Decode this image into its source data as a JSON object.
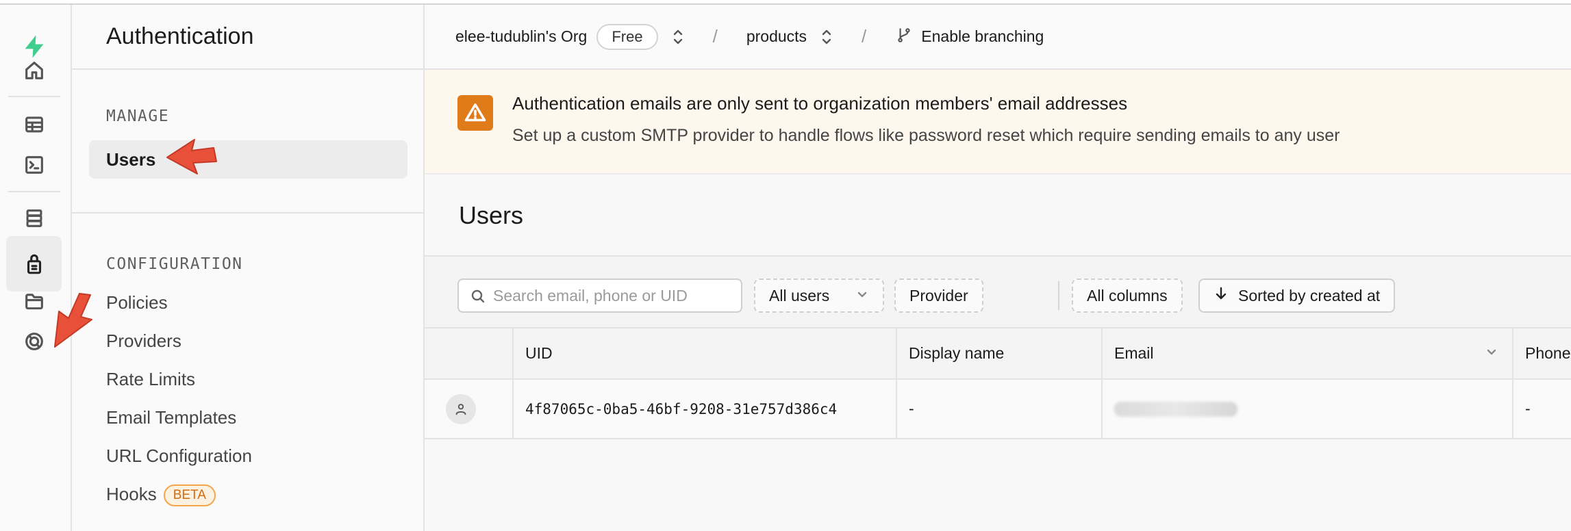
{
  "app": {
    "brand_color": "#3ecf8e",
    "accent_warning": "#e07b1a",
    "annotation_color": "#e8503a"
  },
  "rail": {
    "icons": [
      "logo-icon",
      "home-icon",
      "table-editor-icon",
      "sql-editor-icon",
      "database-icon",
      "authentication-icon",
      "storage-icon",
      "realtime-icon"
    ],
    "active": "authentication-icon"
  },
  "sidebar": {
    "title": "Authentication",
    "sections": [
      {
        "label": "MANAGE",
        "items": [
          {
            "label": "Users",
            "active": true
          }
        ]
      },
      {
        "label": "CONFIGURATION",
        "items": [
          {
            "label": "Policies"
          },
          {
            "label": "Providers"
          },
          {
            "label": "Rate Limits"
          },
          {
            "label": "Email Templates"
          },
          {
            "label": "URL Configuration"
          },
          {
            "label": "Hooks",
            "badge": "BETA"
          }
        ]
      }
    ]
  },
  "breadcrumb": {
    "org": "elee-tudublin's Org",
    "plan": "Free",
    "project": "products",
    "branching": "Enable branching",
    "separator": "/"
  },
  "banner": {
    "title": "Authentication emails are only sent to organization members' email addresses",
    "text": "Set up a custom SMTP provider to handle flows like password reset which require sending emails to any user"
  },
  "page": {
    "title": "Users"
  },
  "toolbar": {
    "search_placeholder": "Search email, phone or UID",
    "filter_value": "All users",
    "provider_label": "Provider",
    "columns_label": "All columns",
    "sort_label": "Sorted by created at"
  },
  "table": {
    "columns": [
      "UID",
      "Display name",
      "Email",
      "Phone"
    ],
    "rows": [
      {
        "uid": "4f87065c-0ba5-46bf-9208-31e757d386c4",
        "display_name": "-",
        "email": "",
        "phone": "-"
      }
    ]
  }
}
